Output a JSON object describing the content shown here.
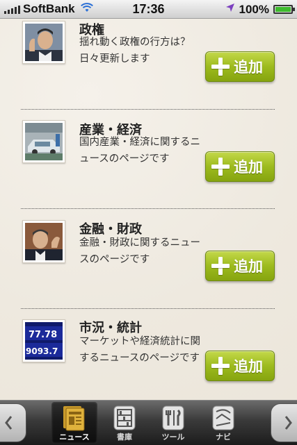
{
  "status_bar": {
    "carrier": "SoftBank",
    "time": "17:36",
    "battery": "100%",
    "battery_level": 1.0,
    "signal_icon": "signal-bars-icon",
    "wifi_icon": "wifi-icon",
    "location_icon": "location-arrow-icon"
  },
  "items": [
    {
      "title": "政権",
      "desc": "揺れ動く政権の行方は？日々更新します",
      "button": "追加",
      "thumb": "politician-photo"
    },
    {
      "title": "産業・経済",
      "desc": "国内産業・経済に関するニュースのページです",
      "button": "追加",
      "thumb": "factory-photo"
    },
    {
      "title": "金融・財政",
      "desc": "金融・財政に関するニュースのページです",
      "button": "追加",
      "thumb": "banker-photo"
    },
    {
      "title": "市況・統計",
      "desc": "マーケットや経済統計に関するニュースのページです",
      "button": "追加",
      "thumb": "stock-board-photo",
      "thumb_numbers": [
        "77.78",
        "9093.7"
      ]
    }
  ],
  "tabs": [
    {
      "label": "ニュース",
      "active": true,
      "icon": "newspaper-icon"
    },
    {
      "label": "書庫",
      "active": false,
      "icon": "bookshelf-icon"
    },
    {
      "label": "ツール",
      "active": false,
      "icon": "tools-icon"
    },
    {
      "label": "ナビ",
      "active": false,
      "icon": "navi-icon"
    }
  ],
  "colors": {
    "button_green": "#9dbb1e",
    "background": "#f1ece3",
    "tabbar": "#2a2a2a"
  }
}
